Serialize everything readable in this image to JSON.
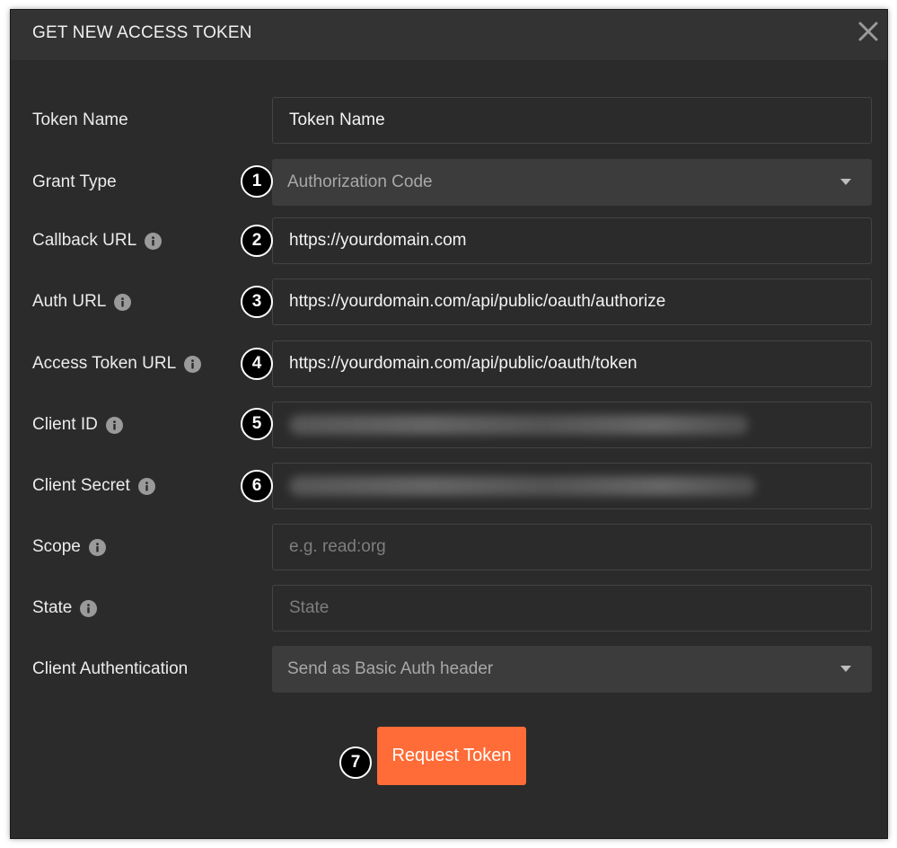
{
  "dialog": {
    "title": "GET NEW ACCESS TOKEN",
    "close_icon": "close-icon"
  },
  "fields": {
    "token_name": {
      "label": "Token Name",
      "value": "Token Name"
    },
    "grant_type": {
      "label": "Grant Type",
      "value": "Authorization Code",
      "badge": "1"
    },
    "callback_url": {
      "label": "Callback URL",
      "value": "https://yourdomain.com",
      "badge": "2"
    },
    "auth_url": {
      "label": "Auth URL",
      "value": "https://yourdomain.com/api/public/oauth/authorize",
      "badge": "3"
    },
    "access_token_url": {
      "label": "Access Token URL",
      "value": "https://yourdomain.com/api/public/oauth/token",
      "badge": "4"
    },
    "client_id": {
      "label": "Client ID",
      "value": "",
      "badge": "5"
    },
    "client_secret": {
      "label": "Client Secret",
      "value": "",
      "badge": "6"
    },
    "scope": {
      "label": "Scope",
      "placeholder": "e.g. read:org"
    },
    "state": {
      "label": "State",
      "placeholder": "State"
    },
    "client_auth": {
      "label": "Client Authentication",
      "value": "Send as Basic Auth header"
    }
  },
  "request_button": {
    "label": "Request Token",
    "badge": "7"
  },
  "colors": {
    "accent": "#ff6c37",
    "dialog_bg": "#2b2b2b",
    "header_bg": "#333333",
    "field_border": "#444444",
    "select_bg": "#3c3c3c"
  }
}
